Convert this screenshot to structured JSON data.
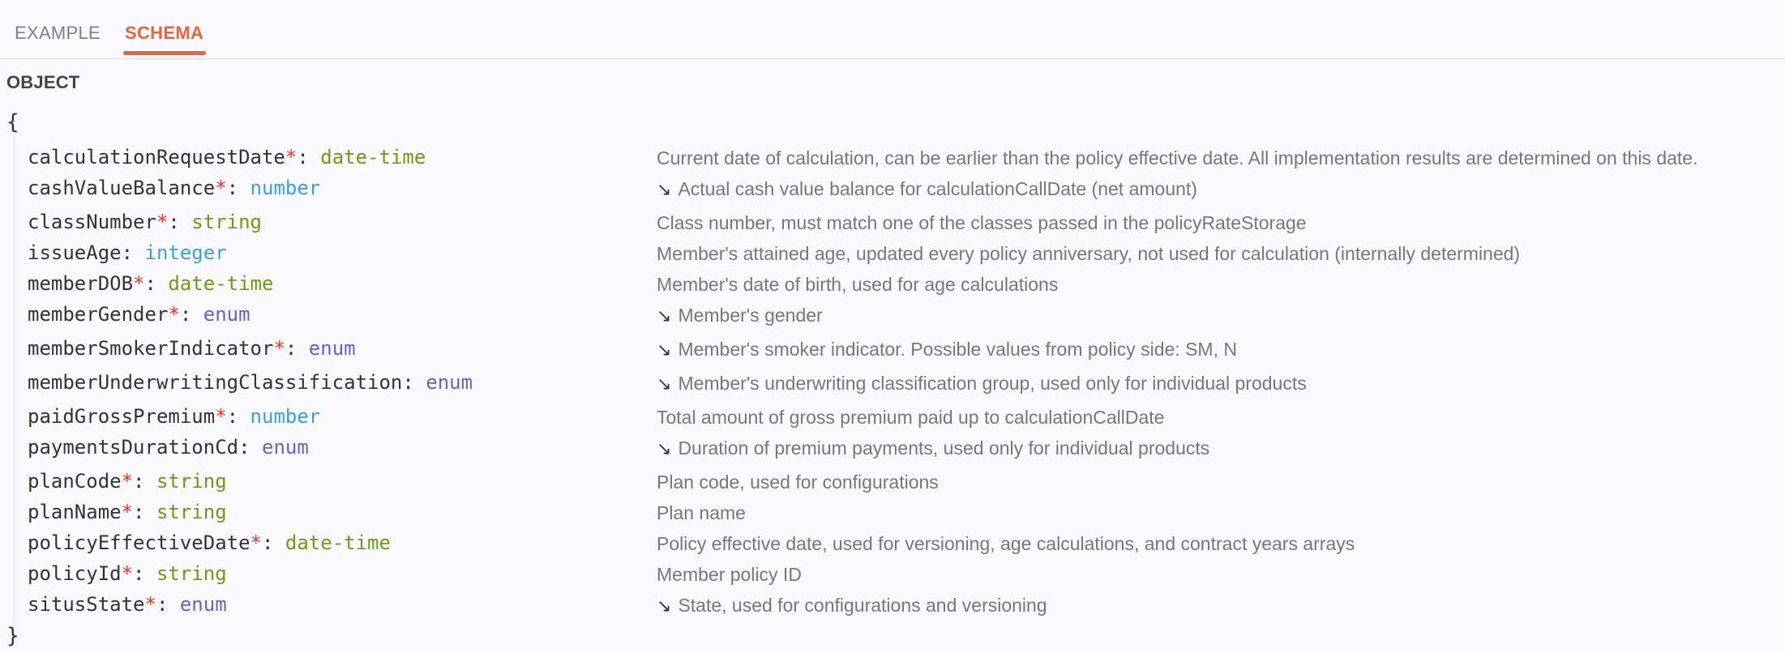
{
  "tabs": [
    {
      "label": "EXAMPLE",
      "active": false
    },
    {
      "label": "SCHEMA",
      "active": true
    }
  ],
  "colors": {
    "accent": "#e8643c",
    "required": "#e0382c",
    "type_string": "#6f9a14",
    "type_number": "#3aa0d8",
    "type_enum": "#6c5ec8"
  },
  "schema": {
    "label": "OBJECT",
    "open_brace": "{",
    "close_brace": "}",
    "required_marker": "*",
    "separator": ":",
    "properties": [
      {
        "name": "calculationRequestDate",
        "required": true,
        "type": "date-time",
        "expandable": false,
        "description": "Current date of calculation, can be earlier than the policy effective date. All implementation results are determined on this date."
      },
      {
        "name": "cashValueBalance",
        "required": true,
        "type": "number",
        "expandable": true,
        "description": "Actual cash value balance for calculationCallDate (net amount)"
      },
      {
        "name": "classNumber",
        "required": true,
        "type": "string",
        "expandable": false,
        "description": "Class number, must match one of the classes passed in the policyRateStorage"
      },
      {
        "name": "issueAge",
        "required": false,
        "type": "integer",
        "expandable": false,
        "description": "Member's attained age, updated every policy anniversary, not used for calculation (internally determined)"
      },
      {
        "name": "memberDOB",
        "required": true,
        "type": "date-time",
        "expandable": false,
        "description": "Member's date of birth, used for age calculations"
      },
      {
        "name": "memberGender",
        "required": true,
        "type": "enum",
        "expandable": true,
        "description": "Member's gender"
      },
      {
        "name": "memberSmokerIndicator",
        "required": true,
        "type": "enum",
        "expandable": true,
        "description": "Member's smoker indicator. Possible values from policy side: SM, N"
      },
      {
        "name": "memberUnderwritingClassification",
        "required": false,
        "type": "enum",
        "expandable": true,
        "description": "Member's underwriting classification group, used only for individual products"
      },
      {
        "name": "paidGrossPremium",
        "required": true,
        "type": "number",
        "expandable": false,
        "description": "Total amount of gross premium paid up to calculationCallDate"
      },
      {
        "name": "paymentsDurationCd",
        "required": false,
        "type": "enum",
        "expandable": true,
        "description": "Duration of premium payments, used only for individual products"
      },
      {
        "name": "planCode",
        "required": true,
        "type": "string",
        "expandable": false,
        "description": "Plan code, used for configurations"
      },
      {
        "name": "planName",
        "required": true,
        "type": "string",
        "expandable": false,
        "description": "Plan name"
      },
      {
        "name": "policyEffectiveDate",
        "required": true,
        "type": "date-time",
        "expandable": false,
        "description": "Policy effective date, used for versioning, age calculations, and contract years arrays"
      },
      {
        "name": "policyId",
        "required": true,
        "type": "string",
        "expandable": false,
        "description": "Member policy ID"
      },
      {
        "name": "situsState",
        "required": true,
        "type": "enum",
        "expandable": true,
        "description": "State, used for configurations and versioning"
      }
    ]
  }
}
